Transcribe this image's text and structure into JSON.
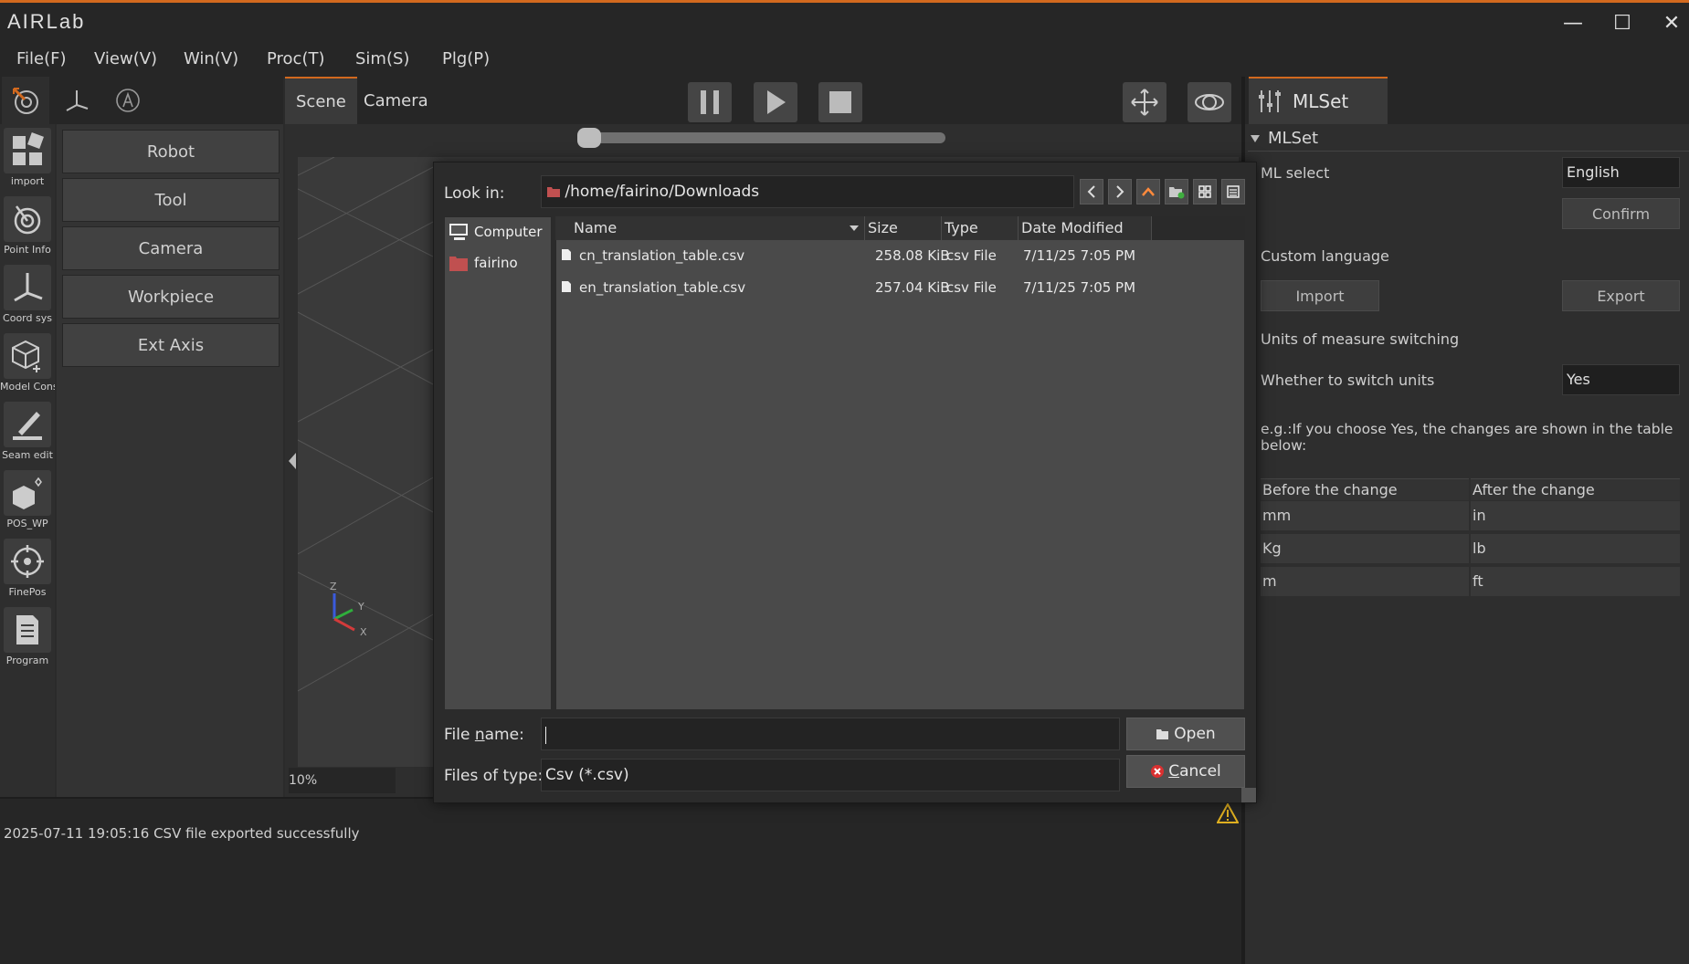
{
  "app": {
    "logo": "AIRLab"
  },
  "window_controls": {
    "minimize": "—",
    "maximize": "☐",
    "close": "✕"
  },
  "menu": [
    "File(F)",
    "View(V)",
    "Win(V)",
    "Proc(T)",
    "Sim(S)",
    "Plg(P)"
  ],
  "left_rail": [
    {
      "label": "import",
      "icon": "import-icon"
    },
    {
      "label": "Point Info",
      "icon": "point-info-icon"
    },
    {
      "label": "Coord sys",
      "icon": "coord-sys-icon"
    },
    {
      "label": "Model Cons",
      "icon": "model-cons-icon"
    },
    {
      "label": "Seam edit",
      "icon": "seam-edit-icon"
    },
    {
      "label": "POS_WP",
      "icon": "pos-wp-icon"
    },
    {
      "label": "FinePos",
      "icon": "finepos-icon"
    },
    {
      "label": "Program",
      "icon": "program-icon"
    }
  ],
  "left_panel": {
    "buttons": [
      "Robot",
      "Tool",
      "Camera",
      "Workpiece",
      "Ext Axis"
    ]
  },
  "scene": {
    "tabs": [
      "Scene",
      "Camera"
    ],
    "zoom": "10%",
    "axis_labels": {
      "z": "Z",
      "y": "Y",
      "x": "X"
    }
  },
  "console": {
    "message": "2025-07-11 19:05:16 CSV file exported successfully"
  },
  "right_panel": {
    "tab": "MLSet",
    "section": "MLSet",
    "ml_select_label": "ML select",
    "ml_select_value": "English",
    "confirm": "Confirm",
    "custom_language": "Custom language",
    "import": "Import",
    "export": "Export",
    "units_switching": "Units of measure switching",
    "switch_units_label": "Whether to switch units",
    "switch_units_value": "Yes",
    "note": "e.g.:If you choose Yes, the changes are shown in the table below:",
    "table": {
      "headers": [
        "Before the change",
        "After the change"
      ],
      "rows": [
        [
          "mm",
          "in"
        ],
        [
          "Kg",
          "lb"
        ],
        [
          "m",
          "ft"
        ]
      ]
    }
  },
  "dialog": {
    "look_in_label": "Look in:",
    "look_in_path": "/home/fairino/Downloads",
    "sidebar": [
      "Computer",
      "fairino"
    ],
    "columns": [
      "Name",
      "Size",
      "Type",
      "Date Modified"
    ],
    "files": [
      {
        "name": "cn_translation_table.csv",
        "size": "258.08 KiB",
        "type": "csv File",
        "date": "7/11/25 7:05 PM"
      },
      {
        "name": "en_translation_table.csv",
        "size": "257.04 KiB",
        "type": "csv File",
        "date": "7/11/25 7:05 PM"
      }
    ],
    "file_name_label_pre": "File ",
    "file_name_label_u": "n",
    "file_name_label_post": "ame:",
    "file_name_value": "",
    "files_of_type_label": "Files of type:",
    "files_of_type_value": "Csv (*.csv)",
    "open": "Open",
    "cancel_u": "C",
    "cancel_rest": "ancel"
  },
  "colors": {
    "accent": "#d2691e",
    "background": "#2b2b2b",
    "dialog_list": "#4a4a4a"
  }
}
